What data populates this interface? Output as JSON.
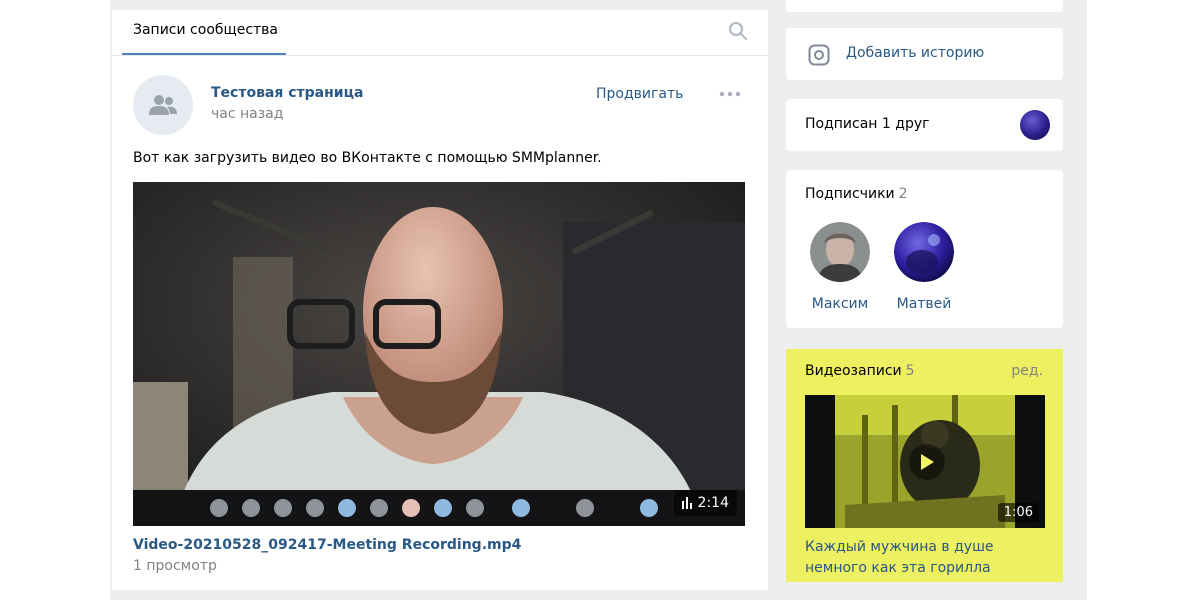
{
  "wall": {
    "tab_label": "Записи сообщества"
  },
  "post": {
    "author": "Тестовая страница",
    "time": "час назад",
    "promote_label": "Продвигать",
    "text": "Вот как загрузить видео во ВКонтакте с помощью SMMplanner.",
    "video": {
      "duration": "2:14",
      "title": "Video-20210528_092417-Meeting Recording.mp4",
      "views": "1 просмотр"
    }
  },
  "sidebar": {
    "story_label": "Добавить историю",
    "friend_label": "Подписан 1 друг",
    "subscribers": {
      "title": "Подписчики",
      "count": "2",
      "items": [
        {
          "name": "Максим"
        },
        {
          "name": "Матвей"
        }
      ]
    },
    "videos": {
      "title": "Видеозаписи",
      "count": "5",
      "edit_label": "ред.",
      "duration": "1:06",
      "caption": "Каждый мужчина в душе немного как эта горилла"
    }
  },
  "colors": {
    "accent": "#2a5885",
    "tab_underline": "#5181b8",
    "highlight": "#ecf061",
    "background": "#edeef0"
  }
}
